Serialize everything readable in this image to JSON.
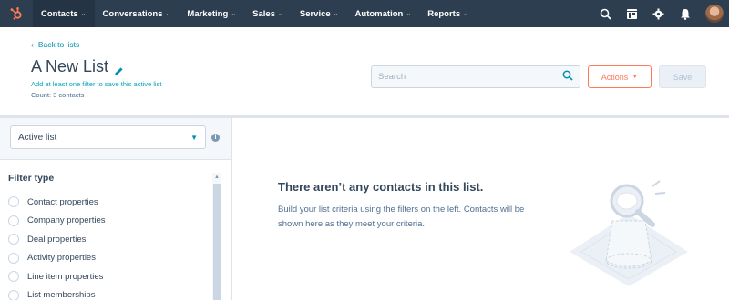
{
  "nav": {
    "items": [
      {
        "label": "Contacts",
        "active": true
      },
      {
        "label": "Conversations",
        "active": false
      },
      {
        "label": "Marketing",
        "active": false
      },
      {
        "label": "Sales",
        "active": false
      },
      {
        "label": "Service",
        "active": false
      },
      {
        "label": "Automation",
        "active": false
      },
      {
        "label": "Reports",
        "active": false
      }
    ],
    "chevron": "⌄",
    "right_icons": [
      "search-icon",
      "marketplace-icon",
      "settings-icon",
      "notifications-icon"
    ]
  },
  "header": {
    "back_label": "Back to lists",
    "title": "A New List",
    "hint": "Add at least one filter to save this active list",
    "count": "Count: 3 contacts"
  },
  "toolbar": {
    "search_placeholder": "Search",
    "actions_label": "Actions",
    "save_label": "Save"
  },
  "sidebar": {
    "list_type": "Active list",
    "filter_title": "Filter type",
    "filters": [
      "Contact properties",
      "Company properties",
      "Deal properties",
      "Activity properties",
      "Line item properties",
      "List memberships"
    ]
  },
  "empty_state": {
    "title": "There aren’t any contacts in this list.",
    "body": "Build your list criteria using the filters on the left. Contacts will be shown here as they meet your criteria."
  },
  "colors": {
    "nav_bg": "#2d3e50",
    "accent_orange": "#ff7a59",
    "link_teal": "#0091ae",
    "text": "#33475b"
  }
}
